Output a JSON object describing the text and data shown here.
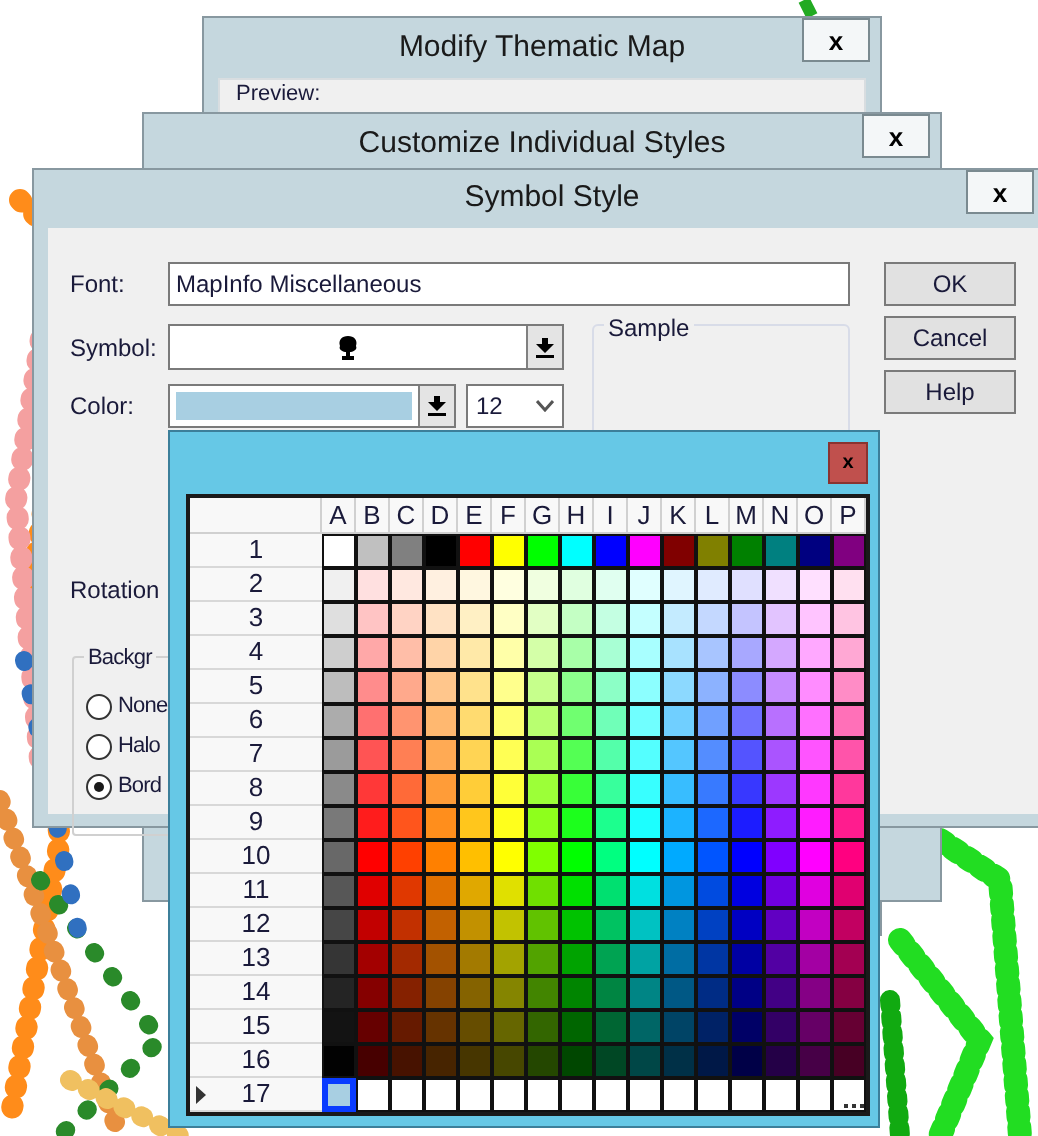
{
  "windows": [
    {
      "title": "Modify Thematic Map",
      "close": "x",
      "preview_label": "Preview:"
    },
    {
      "title": "Customize Individual Styles",
      "close": "x"
    }
  ],
  "symbol_style": {
    "title": "Symbol Style",
    "close": "x",
    "font": {
      "label": "Font:",
      "value": "MapInfo Miscellaneous"
    },
    "symbol": {
      "label": "Symbol:"
    },
    "color": {
      "label": "Color:",
      "color": "#a8cfe2"
    },
    "size": {
      "value": "12"
    },
    "sample": {
      "label": "Sample"
    },
    "rotation": {
      "label": "Rotation"
    },
    "background": {
      "label": "Backgr",
      "options": [
        {
          "label": "None",
          "selected": false
        },
        {
          "label": "Halo",
          "selected": false
        },
        {
          "label": "Bord",
          "selected": true
        }
      ]
    },
    "buttons": [
      "OK",
      "Cancel",
      "Help"
    ]
  },
  "color_picker": {
    "close": "x",
    "columns": [
      "A",
      "B",
      "C",
      "D",
      "E",
      "F",
      "G",
      "H",
      "I",
      "J",
      "K",
      "L",
      "M",
      "N",
      "O",
      "P"
    ],
    "rows": [
      {
        "label": "1",
        "selected": false
      },
      {
        "label": "2",
        "selected": false
      },
      {
        "label": "3",
        "selected": false
      },
      {
        "label": "4",
        "selected": false
      },
      {
        "label": "5",
        "selected": false
      },
      {
        "label": "6",
        "selected": false
      },
      {
        "label": "7",
        "selected": false
      },
      {
        "label": "8",
        "selected": false
      },
      {
        "label": "9",
        "selected": false
      },
      {
        "label": "10",
        "selected": false
      },
      {
        "label": "11",
        "selected": false
      },
      {
        "label": "12",
        "selected": false
      },
      {
        "label": "13",
        "selected": false
      },
      {
        "label": "14",
        "selected": false
      },
      {
        "label": "15",
        "selected": false
      },
      {
        "label": "16",
        "selected": false
      },
      {
        "label": "17",
        "selected": true
      }
    ]
  }
}
